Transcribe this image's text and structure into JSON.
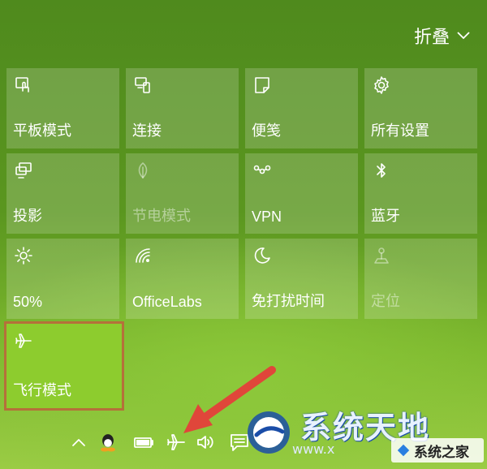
{
  "header": {
    "collapse_label": "折叠",
    "collapse_icon": "chevron-down-icon"
  },
  "tiles": [
    {
      "label": "平板模式",
      "icon": "tablet-mode-icon",
      "state": "normal"
    },
    {
      "label": "连接",
      "icon": "connect-icon",
      "state": "normal"
    },
    {
      "label": "便笺",
      "icon": "note-icon",
      "state": "normal"
    },
    {
      "label": "所有设置",
      "icon": "gear-icon",
      "state": "normal"
    },
    {
      "label": "投影",
      "icon": "project-icon",
      "state": "normal"
    },
    {
      "label": "节电模式",
      "icon": "battery-saver-icon",
      "state": "disabled"
    },
    {
      "label": "VPN",
      "icon": "vpn-icon",
      "state": "normal"
    },
    {
      "label": "蓝牙",
      "icon": "bluetooth-icon",
      "state": "normal"
    },
    {
      "label": "50%",
      "icon": "brightness-icon",
      "state": "normal"
    },
    {
      "label": "OfficeLabs",
      "icon": "wifi-icon",
      "state": "normal"
    },
    {
      "label": "免打扰时间",
      "icon": "moon-icon",
      "state": "normal"
    },
    {
      "label": "定位",
      "icon": "location-icon",
      "state": "disabled"
    },
    {
      "label": "飞行模式",
      "icon": "airplane-icon",
      "state": "active"
    }
  ],
  "taskbar": {
    "icons": [
      "chevron-up-icon",
      "qq-icon",
      "battery-icon",
      "airplane-icon",
      "volume-icon",
      "action-center-icon"
    ]
  },
  "watermark": {
    "main": "系统天地",
    "sub": "www.x",
    "badge": "系统之家"
  },
  "colors": {
    "active_tile": "#8dcc2e",
    "highlight_border": "#b5703a",
    "arrow": "#e0463a"
  }
}
